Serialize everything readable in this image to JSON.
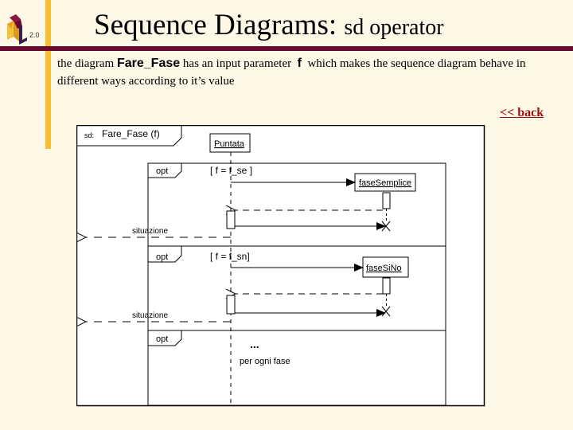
{
  "header": {
    "logo_text": "2.0",
    "logo_icon": "uml-logo-icon",
    "title_main": "Sequence Diagrams:",
    "title_sub": "sd operator"
  },
  "description": {
    "part1": "the diagram ",
    "diagram_name": "Fare_Fase",
    "part2": " has an input parameter ",
    "param": "f",
    "part3": " which makes the sequence diagram behave in different ways according to it’s value"
  },
  "nav": {
    "back_label": "<< back"
  },
  "diagram": {
    "frame_label_prefix": "sd:",
    "frame_label": "Fare_Fase (f)",
    "lifeline": "Puntata",
    "fragments": [
      {
        "operator": "opt",
        "guard": "[ f = f_se ]",
        "target": "faseSemplice",
        "return_label": "situazione"
      },
      {
        "operator": "opt",
        "guard": "[ f = f_sn]",
        "target": "faseSiNo",
        "return_label": "situazione"
      },
      {
        "operator": "opt",
        "ellipsis": "...",
        "note": "per ogni fase"
      }
    ]
  }
}
